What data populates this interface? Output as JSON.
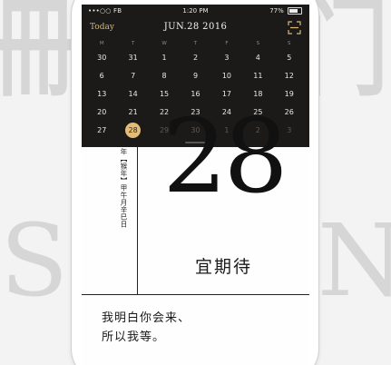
{
  "watermark": {
    "left_top": "冊",
    "left_bottom": "SI",
    "right_top": "门",
    "right_bottom": "N"
  },
  "statusbar": {
    "left": "•••○○ FB",
    "time": "1:20 PM",
    "battery": "77%"
  },
  "nav": {
    "today_label": "Today",
    "month_title": "JUN.28 2016"
  },
  "weekdays": [
    "M",
    "T",
    "W",
    "T",
    "F",
    "S",
    "S"
  ],
  "calendar": {
    "rows": [
      [
        "30",
        "31",
        "1",
        "2",
        "3",
        "4",
        "5"
      ],
      [
        "6",
        "7",
        "8",
        "9",
        "10",
        "11",
        "12"
      ],
      [
        "13",
        "14",
        "15",
        "16",
        "17",
        "18",
        "19"
      ],
      [
        "20",
        "21",
        "22",
        "23",
        "24",
        "25",
        "26"
      ],
      [
        "27",
        "28",
        "29",
        "30",
        "1",
        "2",
        "3"
      ]
    ],
    "selected_day": "28"
  },
  "detail": {
    "lunar": "年【猴年】甲午月辛巳日",
    "big_day": "28",
    "yi": "宜期待",
    "quote_line1": "我明白你会来、",
    "quote_line2": "所以我等。"
  },
  "colors": {
    "accent": "#e3bd78",
    "dark_bg": "#1b1a18",
    "today_text": "#d7b77a"
  }
}
